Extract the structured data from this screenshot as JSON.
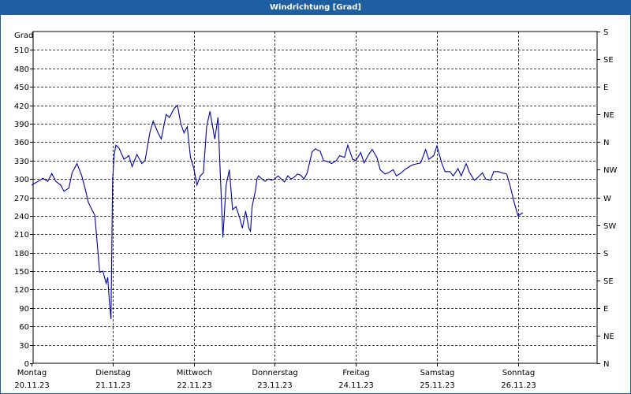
{
  "title": "Windrichtung [Grad]",
  "chart_data": {
    "type": "line",
    "title": "Windrichtung [Grad]",
    "ylabel": "Grad",
    "ylim": [
      0,
      540
    ],
    "y_ticks": [
      0,
      30,
      60,
      90,
      120,
      150,
      180,
      210,
      240,
      270,
      300,
      330,
      360,
      390,
      420,
      450,
      480,
      510
    ],
    "y_right_ticks": [
      "N",
      "NE",
      "E",
      "SE",
      "S",
      "SW",
      "W",
      "NW",
      "N",
      "NE",
      "E",
      "SE",
      "S"
    ],
    "x_ticks": [
      {
        "day": "Montag",
        "date": "20.11.23",
        "t": 0
      },
      {
        "day": "Dienstag",
        "date": "21.11.23",
        "t": 1
      },
      {
        "day": "Mittwoch",
        "date": "22.11.23",
        "t": 2
      },
      {
        "day": "Donnerstag",
        "date": "23.11.23",
        "t": 3
      },
      {
        "day": "Freitag",
        "date": "24.11.23",
        "t": 4
      },
      {
        "day": "Samstag",
        "date": "25.11.23",
        "t": 5
      },
      {
        "day": "Sonntag",
        "date": "26.11.23",
        "t": 6
      }
    ],
    "xlim": [
      0,
      7.05
    ],
    "grid": true,
    "line_color": "#0000aa",
    "series": [
      {
        "t": [
          0.0,
          0.08,
          0.14,
          0.2,
          0.25,
          0.3,
          0.36,
          0.4,
          0.46,
          0.5,
          0.56,
          0.62,
          0.66,
          0.7,
          0.74,
          0.78,
          0.84,
          0.88,
          0.92,
          0.94,
          0.96,
          0.98,
          1.0,
          1.02,
          1.04,
          1.08,
          1.14,
          1.2,
          1.24,
          1.3,
          1.36,
          1.4,
          1.46,
          1.5,
          1.56,
          1.6,
          1.66,
          1.7,
          1.76,
          1.8,
          1.84,
          1.88,
          1.9,
          1.92,
          1.96,
          2.0,
          2.04,
          2.08,
          2.12,
          2.16,
          2.2,
          2.26,
          2.3,
          2.36,
          2.4,
          2.44,
          2.48,
          2.52,
          2.56,
          2.6,
          2.64,
          2.68,
          2.7,
          2.72,
          2.76,
          2.78,
          2.8,
          2.84,
          2.88,
          2.92,
          2.96,
          3.0,
          3.04,
          3.08,
          3.12,
          3.16,
          3.2,
          3.24,
          3.28,
          3.32,
          3.36,
          3.4,
          3.46,
          3.5,
          3.56,
          3.6,
          3.66,
          3.7,
          3.76,
          3.8,
          3.86,
          3.9,
          3.96,
          4.0,
          4.06,
          4.1,
          4.16,
          4.2,
          4.26,
          4.3,
          4.36,
          4.4,
          4.46,
          4.5,
          4.56,
          4.6,
          4.66,
          4.7,
          4.76,
          4.8,
          4.86,
          4.9,
          4.96,
          5.0,
          5.06,
          5.1,
          5.16,
          5.2,
          5.26,
          5.3,
          5.36,
          5.4,
          5.46,
          5.5,
          5.56,
          5.6,
          5.66,
          5.7,
          5.76,
          5.8,
          5.86,
          5.9,
          5.96,
          6.0,
          6.06,
          6.1,
          6.16,
          6.2,
          6.26,
          6.3,
          6.36,
          6.4,
          6.46,
          6.5,
          6.56,
          6.6,
          6.66,
          6.7,
          6.76,
          6.8,
          6.86,
          6.9,
          6.94,
          6.98,
          7.02
        ],
        "values": [
          290,
          296,
          301,
          296,
          309,
          296,
          290,
          280,
          285,
          310,
          325,
          305,
          285,
          262,
          251,
          241,
          148,
          150,
          130,
          140,
          100,
          72,
          300,
          340,
          355,
          350,
          332,
          338,
          320,
          340,
          325,
          330,
          376,
          394,
          375,
          365,
          405,
          400,
          415,
          420,
          390,
          375,
          380,
          385,
          335,
          318,
          290,
          305,
          310,
          385,
          410,
          365,
          400,
          205,
          290,
          315,
          250,
          255,
          240,
          220,
          248,
          220,
          215,
          255,
          280,
          300,
          305,
          300,
          296,
          300,
          298,
          300,
          305,
          300,
          295,
          305,
          300,
          303,
          308,
          306,
          300,
          310,
          344,
          349,
          345,
          330,
          328,
          325,
          330,
          338,
          335,
          355,
          332,
          330,
          343,
          326,
          340,
          348,
          335,
          315,
          308,
          310,
          315,
          305,
          310,
          315,
          320,
          323,
          325,
          326,
          348,
          332,
          338,
          354,
          325,
          312,
          312,
          305,
          317,
          305,
          325,
          311,
          298,
          302,
          310,
          300,
          298,
          312,
          312,
          310,
          308,
          290,
          258,
          240,
          245
        ],
        "name": ""
      }
    ]
  }
}
